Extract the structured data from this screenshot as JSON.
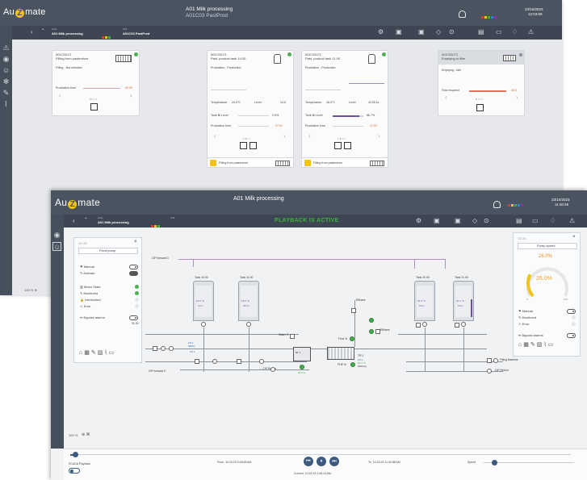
{
  "back": {
    "logo_left": "Au",
    "logo_z": "Z",
    "logo_right": "mate",
    "title_line1": "A01 Milk processing",
    "title_line2": "A01C03 PastProd",
    "date": "23/10/2023",
    "time": "12:03:59",
    "area_label": "Area",
    "area_value": "A01 Milk processing",
    "cell_label": "Cell",
    "cell_value": "A01C03 PastProd",
    "cards": [
      {
        "id": "A01C03U71",
        "name": "Filling from pasteurizer",
        "status": "Filling - Not selected",
        "metric": "Production time",
        "metric_value": "00:00"
      },
      {
        "id": "A01C03U71",
        "name": "Past. product tank 10.00",
        "status": "Production - Production",
        "temp_label": "Temperature",
        "temp": "24.0°C",
        "level_label": "Level",
        "level": "14.6",
        "fill_label": "Tank fill Level",
        "fill": "0.0%",
        "time_label": "Production time",
        "time": "37:02",
        "footer": "Filling from pasteurizer"
      },
      {
        "id": "A01C03U72",
        "name": "Past. product tank 11.00",
        "status": "Production - Production",
        "temp_label": "Temperature",
        "temp": "18.0°C",
        "level_label": "Level",
        "level": "43.55 kL",
        "fill_label": "Tank fill Level",
        "fill": "86.7%",
        "time_label": "Production time",
        "time": "37:02",
        "footer": "Filling from pasteurizer"
      },
      {
        "id": "A01C03U73",
        "name": "Emptying to filler",
        "status": "Emptying - Idle",
        "metric": "Flow required",
        "metric_value": "48.5"
      }
    ]
  },
  "front": {
    "logo_left": "Au",
    "logo_z": "Z",
    "logo_right": "mate",
    "title": "A01 Milk processing",
    "date": "23/10/2023",
    "time": "11:40:46",
    "area_label": "Area",
    "area_value": "A01 Milk processing",
    "cell_label": "Cell",
    "playback_banner": "PLAYBACK IS ACTIVE",
    "left_panel": {
      "header": "S0.26",
      "subheader": "Feed pump",
      "rows": [
        "Manual",
        "Activate",
        "Motor State",
        "Monitored",
        "Interlocked",
        "Error",
        "Bypass alarms"
      ]
    },
    "right_panel": {
      "header": "S0.26",
      "subheader": "Pump speed",
      "top_value": "26.0%",
      "gauge_value": "26.0%",
      "gauge_min": "0",
      "gauge_max": "100",
      "gauge_fraction": 0.26,
      "rows": [
        "Manual",
        "Monitored",
        "Error",
        "Bypass alarms"
      ]
    },
    "diagram": {
      "cip_forward_top": "CIP forward 3",
      "cip_forward_low": "CIP forward 3",
      "cip_return": "← CIP Return",
      "tank1": "Tank 10.00",
      "tank2": "Tank 11.00",
      "tank3": "Tank 20.00",
      "tank4": "Tank 21.00",
      "tank1_temp": "24.0 °C",
      "tank1_lvl": "0.0 L",
      "tank2_temp": "18.0 °C",
      "tank2_lvl": "43.5 L",
      "tank3_temp": "24.0 °C",
      "tank3_lvl": "0.0 L",
      "tank4_temp": "22.1 °C",
      "tank4_lvl": "0.0 L",
      "water": "Water 3",
      "effluent_top": "Effluent",
      "effluent_right": "Effluent",
      "flow_label": "Flow %",
      "pct_label": "PHE %",
      "filling_machine": "Filling Machine",
      "cip_return_right": "CIP Return",
      "tag_left": "31.00",
      "hx_label": "TR 1",
      "hx_val1": "3.6 L",
      "hx_val2": "50.4 °C",
      "hx_val3": "3000 kg",
      "pump_val": "26.0 %",
      "tag_a": "0.0 L",
      "tag_b": "3000 L",
      "tag_c": "0.0 L"
    },
    "zoom": "100 %",
    "bottom": {
      "scada_label": "SCADA Playback",
      "from_label": "From",
      "from_value": "10.23.23 2:45:58 AM",
      "to_label": "To",
      "to_value": "10.23.23 11:40:58 AM",
      "current_label": "Current",
      "current_value": "10.23.23 2:45:14 AM",
      "speed_label": "Speed",
      "progress_fraction": 0.01,
      "speed_fraction": 0.12
    }
  },
  "colors": {
    "header": "#4a5360",
    "accent_yellow": "#f4c313",
    "playback_green": "#3fb43a",
    "gauge_yellow": "#f0c419",
    "gauge_orange": "#f28c28",
    "pipe_purple": "#b58acb"
  }
}
